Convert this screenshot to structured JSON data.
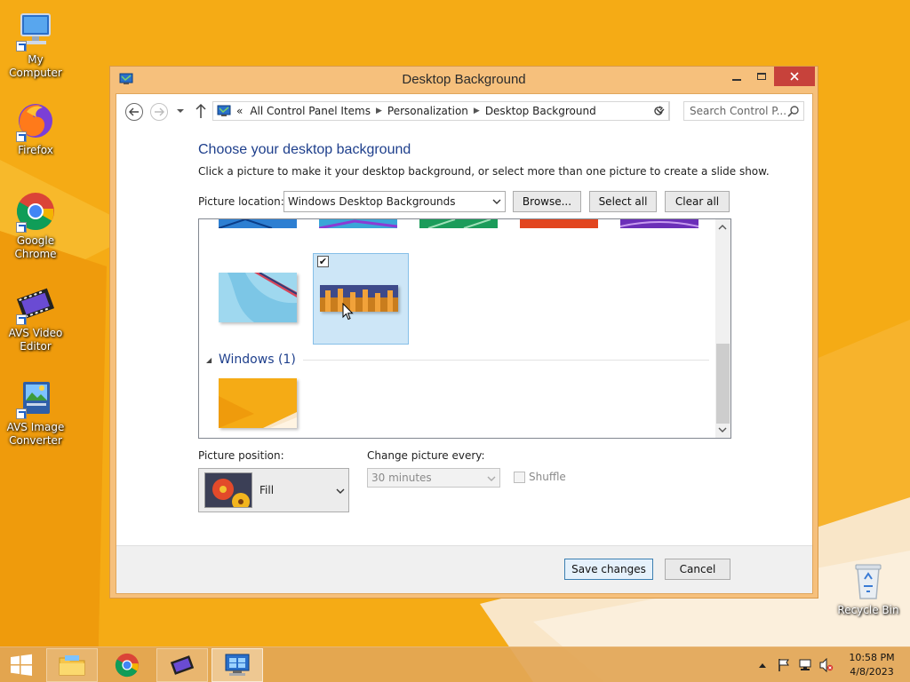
{
  "desktop": {
    "icons": [
      {
        "label": "My Computer"
      },
      {
        "label": "Firefox"
      },
      {
        "label": "Google Chrome"
      },
      {
        "label": "AVS Video Editor"
      },
      {
        "label": "AVS Image Converter"
      },
      {
        "label": "Recycle Bin"
      }
    ]
  },
  "window": {
    "title": "Desktop Background",
    "breadcrumb": {
      "overflow": "«",
      "items": [
        "All Control Panel Items",
        "Personalization",
        "Desktop Background"
      ]
    },
    "search_placeholder": "Search Control P...",
    "heading": "Choose your desktop background",
    "subtext": "Click a picture to make it your desktop background, or select more than one picture to create a slide show.",
    "picture_location": {
      "label": "Picture location:",
      "value": "Windows Desktop Backgrounds"
    },
    "buttons": {
      "browse": "Browse...",
      "select_all": "Select all",
      "clear_all": "Clear all",
      "save": "Save changes",
      "cancel": "Cancel"
    },
    "gallery": {
      "selected_checkmark": "✔",
      "group_header": "Windows (1)"
    },
    "picture_position": {
      "label": "Picture position:",
      "value": "Fill"
    },
    "change_picture": {
      "label": "Change picture every:",
      "value": "30 minutes",
      "disabled": true
    },
    "shuffle": {
      "label": "Shuffle",
      "checked": false,
      "disabled": true
    }
  },
  "taskbar": {
    "clock_time": "10:58 PM",
    "clock_date": "4/8/2023",
    "items": [
      "file-explorer",
      "google-chrome",
      "avs-video-editor",
      "control-panel"
    ]
  },
  "colors": {
    "heading": "#1e3f8c",
    "selection": "#cde6f7",
    "close_button": "#c7423b",
    "wallpaper": "#f3a716"
  }
}
